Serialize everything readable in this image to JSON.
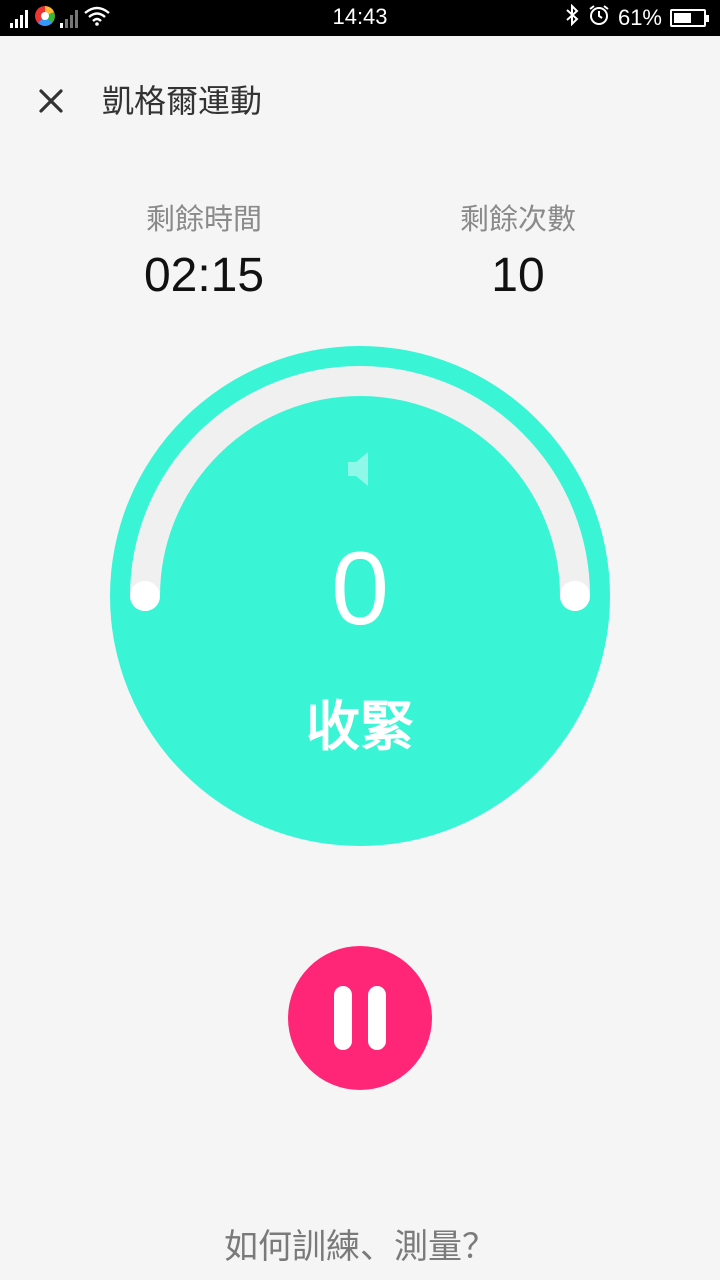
{
  "status_bar": {
    "time": "14:43",
    "battery_text": "61%",
    "battery_level": 0.61,
    "icons": [
      "signal-icon",
      "color-app-icon",
      "signal-2-icon",
      "wifi-icon",
      "bluetooth-icon",
      "alarm-icon",
      "battery-icon"
    ]
  },
  "header": {
    "close_icon": "close-icon",
    "title": "凱格爾運動"
  },
  "stats": {
    "remaining_time_label": "剩餘時間",
    "remaining_time_value": "02:15",
    "remaining_count_label": "剩餘次數",
    "remaining_count_value": "10"
  },
  "dial": {
    "count": "0",
    "phase": "收緊",
    "sound_icon": "speaker-icon",
    "progress": 0,
    "accent_color": "#3af4d6",
    "track_color": "#f0f0f0"
  },
  "controls": {
    "pause_icon": "pause-icon",
    "pause_color": "#ff2677"
  },
  "footer": {
    "help_link": "如何訓練、測量？"
  }
}
